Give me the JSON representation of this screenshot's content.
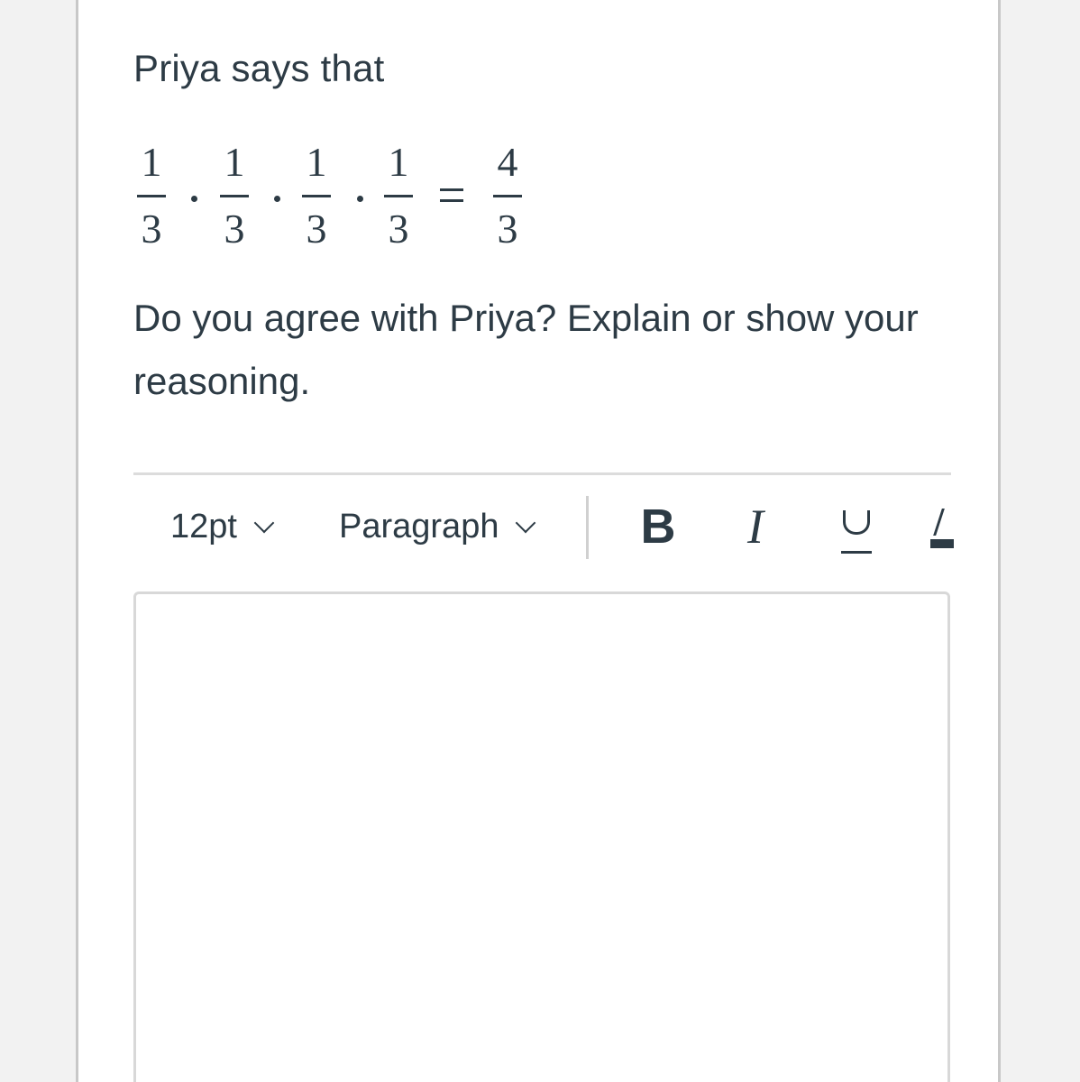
{
  "question": {
    "lead": "Priya says that",
    "equation": {
      "fractions": [
        {
          "numerator": "1",
          "denominator": "3"
        },
        {
          "numerator": "1",
          "denominator": "3"
        },
        {
          "numerator": "1",
          "denominator": "3"
        },
        {
          "numerator": "1",
          "denominator": "3"
        }
      ],
      "result": {
        "numerator": "4",
        "denominator": "3"
      }
    },
    "prompt": "Do you agree with Priya? Explain or show your reasoning."
  },
  "toolbar": {
    "font_size": "12pt",
    "block_format": "Paragraph",
    "bold_label": "B",
    "italic_label": "I",
    "underline_icon": "underline-icon",
    "text_color_icon": "text-color-icon"
  },
  "editor": {
    "value": ""
  },
  "colors": {
    "text": "#2d3b45",
    "border": "#d8d8d8"
  }
}
